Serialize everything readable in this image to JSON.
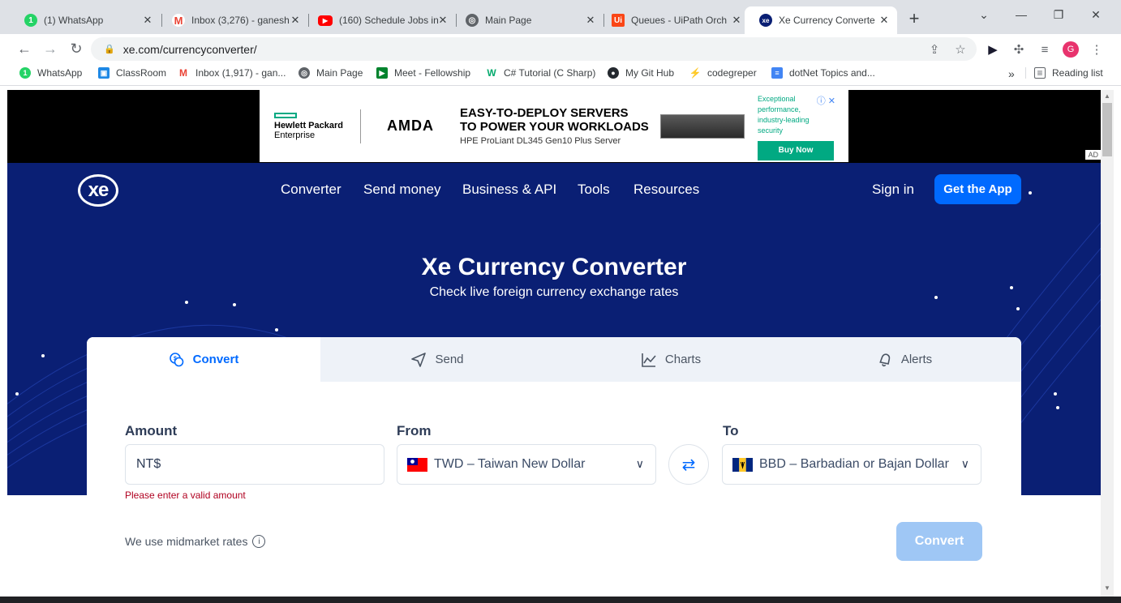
{
  "browser": {
    "tabs": [
      {
        "title": "(1) WhatsApp",
        "icon": "whatsapp-icon",
        "color": "#25d366"
      },
      {
        "title": "Inbox (3,276) - ganesh",
        "icon": "gmail-icon",
        "color": "#ea4335"
      },
      {
        "title": "(160) Schedule Jobs in",
        "icon": "youtube-icon",
        "color": "#ff0000"
      },
      {
        "title": "Main Page",
        "icon": "globe-icon",
        "color": "#5f6368"
      },
      {
        "title": "Queues - UiPath Orch",
        "icon": "uipath-icon",
        "color": "#fa4616"
      },
      {
        "title": "Xe Currency Converte",
        "icon": "xe-icon",
        "color": "#0a1f74"
      }
    ],
    "url": "xe.com/currencyconverter/",
    "bookmarks": [
      {
        "label": "WhatsApp",
        "icon": "whatsapp-icon",
        "color": "#25d366"
      },
      {
        "label": "ClassRoom",
        "icon": "classroom-icon",
        "color": "#1e88e5"
      },
      {
        "label": "Inbox (1,917) - gan...",
        "icon": "gmail-icon",
        "color": "#ea4335"
      },
      {
        "label": "Main Page",
        "icon": "globe-icon",
        "color": "#5f6368"
      },
      {
        "label": "Meet - Fellowship",
        "icon": "meet-icon",
        "color": "#00832d"
      },
      {
        "label": "C# Tutorial (C Sharp)",
        "icon": "w3-icon",
        "color": "#04aa6d"
      },
      {
        "label": "My Git Hub",
        "icon": "github-icon",
        "color": "#24292f"
      },
      {
        "label": "codegreper",
        "icon": "grepper-icon",
        "color": "#7cb342"
      },
      {
        "label": "dotNet Topics and...",
        "icon": "docs-icon",
        "color": "#4285f4"
      }
    ],
    "reading_list": "Reading list",
    "more": "»",
    "profile_initial": "G"
  },
  "ad": {
    "brand_line1": "Hewlett Packard",
    "brand_line2": "Enterprise",
    "partner": "AMDA",
    "headline1": "EASY-TO-DEPLOY SERVERS",
    "headline2": "TO POWER YOUR WORKLOADS",
    "product": "HPE ProLiant DL345 Gen10 Plus Server",
    "side_text": "Exceptional performance, industry-leading security",
    "cta": "Buy Now",
    "tag": "AD"
  },
  "site": {
    "logo": "xe",
    "nav": [
      "Converter",
      "Send money",
      "Business & API",
      "Tools",
      "Resources"
    ],
    "sign_in": "Sign in",
    "get_app": "Get the App",
    "title": "Xe Currency Converter",
    "subtitle": "Check live foreign currency exchange rates"
  },
  "converter": {
    "tabs": [
      {
        "label": "Convert",
        "icon": "coins-icon",
        "active": true
      },
      {
        "label": "Send",
        "icon": "send-icon",
        "active": false
      },
      {
        "label": "Charts",
        "icon": "chart-icon",
        "active": false
      },
      {
        "label": "Alerts",
        "icon": "bell-icon",
        "active": false
      }
    ],
    "amount_label": "Amount",
    "amount_value": "NT$",
    "from_label": "From",
    "from_value": "TWD – Taiwan New Dollar",
    "to_label": "To",
    "to_value": "BBD – Barbadian or Bajan Dollar",
    "error": "Please enter a valid amount",
    "midmarket": "We use midmarket rates",
    "convert_button": "Convert"
  },
  "colors": {
    "hero": "#0a1f74",
    "accent": "#006aff",
    "disabled_button": "#9fc7f5"
  }
}
